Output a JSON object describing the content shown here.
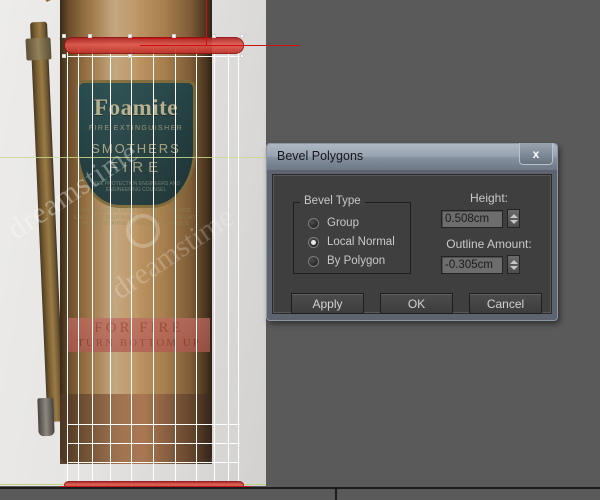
{
  "viewport": {
    "name": "perspective-viewport",
    "reference_image": {
      "subject": "vintage brass fire extinguisher",
      "brand": "Foamite",
      "line_sub": "FIRE EXTINGUISHER",
      "line_smothers": "SMOTHERS",
      "line_fire": "FIRE",
      "fine_print": "FIRE PROTECTION ENGINEERS AND ENGINEERING COUNSEL",
      "body_text": "THE SOLUTION SHOULD BE RENEWED ONCE EACH YEAR. KEEP IN A PLACE WHERE IT WILL NOT FREEZE. EXAMINE AT REGULAR INTERVALS.",
      "red_band_line1": "FOR FIRE",
      "red_band_line2": "TURN BOTTOM UP",
      "watermark": "dreamstime"
    },
    "selection_color": "#c03028",
    "wireframe_color": "#ffffff",
    "grid_axis_color": "#c8d98a",
    "background_color": "#5a5a5a"
  },
  "dialog": {
    "title": "Bevel Polygons",
    "close_label": "x",
    "bevel_type": {
      "group_label": "Bevel Type",
      "options": [
        {
          "label": "Group",
          "selected": false
        },
        {
          "label": "Local Normal",
          "selected": true
        },
        {
          "label": "By Polygon",
          "selected": false
        }
      ]
    },
    "fields": [
      {
        "label": "Height:",
        "value": "0.508cm"
      },
      {
        "label": "Outline Amount:",
        "value": "-0.305cm"
      }
    ],
    "buttons": [
      {
        "label": "Apply"
      },
      {
        "label": "OK"
      },
      {
        "label": "Cancel"
      }
    ]
  }
}
